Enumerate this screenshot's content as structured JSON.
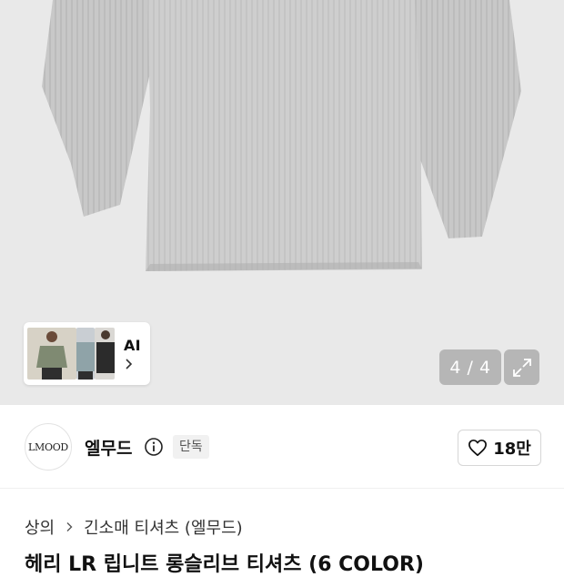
{
  "hero": {
    "counter": "4 / 4",
    "ai_label": "AI",
    "product_alt": "gray ribbed long sleeve t-shirt"
  },
  "brand": {
    "logo_text": "LMOOD",
    "name": "엘무드",
    "badge": "단독"
  },
  "like": {
    "count": "18만"
  },
  "breadcrumb": {
    "items": [
      "상의",
      "긴소매 티셔츠 (엘무드)"
    ]
  },
  "product": {
    "title_partial": "헤리 LR 립니트 롱슬리브 티셔츠 (6 COLOR)"
  },
  "icons": [
    "chevron-right-icon",
    "expand-icon",
    "info-icon",
    "heart-icon"
  ],
  "colors": {
    "hero_bg": "#e9e9e9",
    "shirt": "#c9c9c9",
    "badge_bg": "#f1f1f1"
  }
}
